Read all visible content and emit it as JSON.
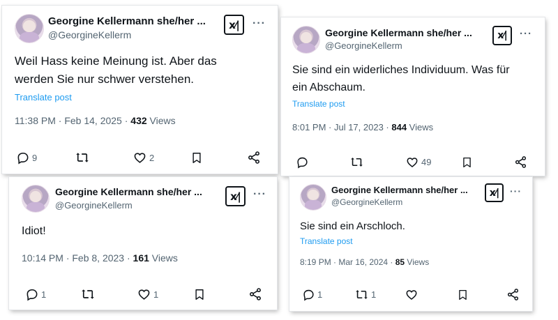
{
  "posts": [
    {
      "display_name": "Georgine Kellermann she/her ...",
      "handle": "@GeorgineKellerm",
      "more": "···",
      "lines": [
        "Weil Hass keine Meinung ist. Aber das",
        "werden Sie nur schwer verstehen."
      ],
      "translate": "Translate post",
      "time": "11:38 PM · Feb 14, 2025 · ",
      "views_count": "432",
      "views_label": " Views",
      "replies": "9",
      "reposts": "",
      "likes": "2"
    },
    {
      "display_name": "Georgine Kellermann she/her ...",
      "handle": "@GeorgineKellerm",
      "more": "···",
      "lines": [
        "Sie sind ein widerliches Individuum. Was für",
        "ein Abschaum."
      ],
      "translate": "Translate post",
      "time": "8:01 PM · Jul 17, 2023 · ",
      "views_count": "844",
      "views_label": " Views",
      "replies": "",
      "reposts": "",
      "likes": "49"
    },
    {
      "display_name": "Georgine Kellermann she/her ...",
      "handle": "@GeorgineKellerm",
      "more": "···",
      "lines": [
        "Idiot!"
      ],
      "time": "10:14 PM · Feb 8, 2023 · ",
      "views_count": "161",
      "views_label": " Views",
      "replies": "1",
      "reposts": "",
      "likes": "1"
    },
    {
      "display_name": "Georgine Kellermann she/her ...",
      "handle": "@GeorgineKellerm",
      "more": "···",
      "lines": [
        "Sie sind ein Arschloch."
      ],
      "translate": "Translate post",
      "time": "8:19 PM · Mar 16, 2024 · ",
      "views_count": "85",
      "views_label": " Views",
      "replies": "1",
      "reposts": "1",
      "likes": ""
    }
  ],
  "logo_glyph": "x⁄|",
  "icons": {
    "reply": "reply-icon",
    "repost": "repost-icon",
    "like": "like-icon",
    "bookmark": "bookmark-icon",
    "share": "share-icon",
    "logo": "x-logo-icon"
  },
  "colors": {
    "text": "#0f1419",
    "secondary": "#536471",
    "link": "#1d9bf0"
  }
}
